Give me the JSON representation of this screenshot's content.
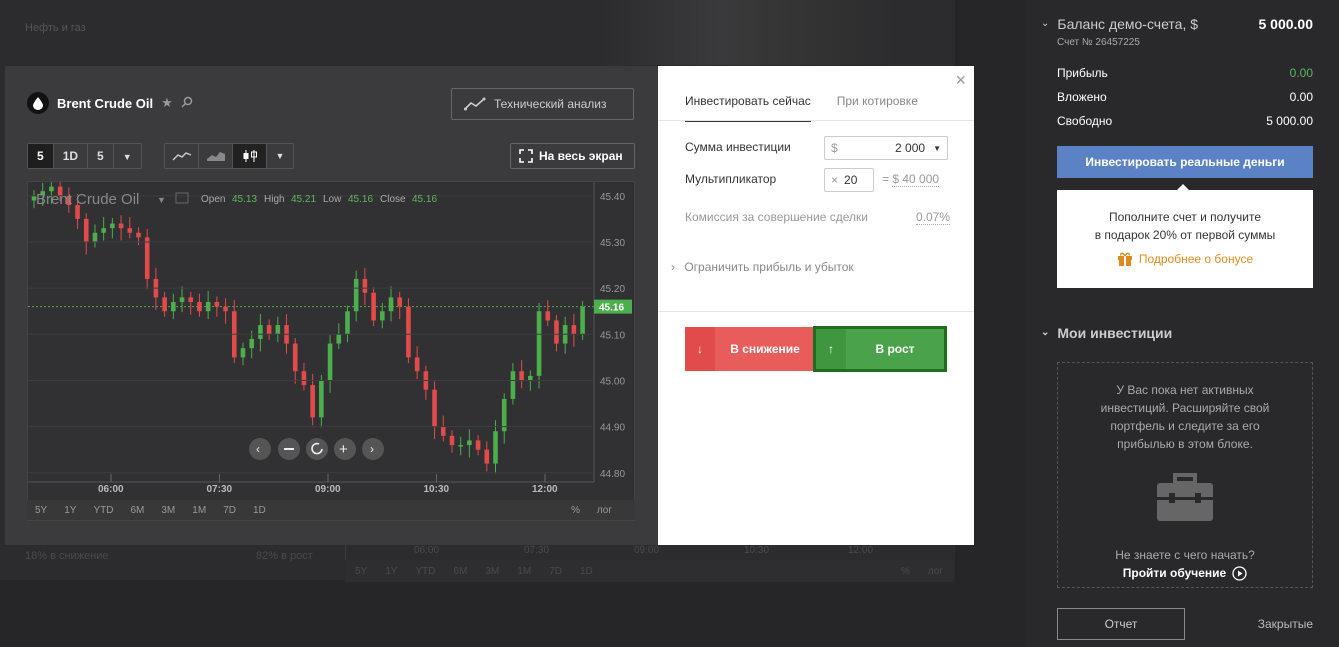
{
  "background": {
    "title": "Нефть и газ",
    "stat_down": "18% в снижение",
    "stat_up": "82% в рост",
    "axis_times": [
      "06:00",
      "07:30",
      "09:00",
      "10:30",
      "12:00"
    ],
    "ranges": [
      "5Y",
      "1Y",
      "YTD",
      "6M",
      "3M",
      "1M",
      "7D",
      "1D"
    ],
    "pct": "%",
    "log": "лог"
  },
  "chart_panel": {
    "asset_name": "Brent Crude Oil",
    "tech_button": "Технический анализ",
    "timeframes": [
      "5",
      "1D",
      "5"
    ],
    "fullscreen": "На весь экран"
  },
  "chart_data": {
    "type": "candlestick",
    "title": "Brent Crude Oil",
    "ohlc_labels": {
      "open_label": "Open",
      "open": "45.13",
      "high_label": "High",
      "high": "45.21",
      "low_label": "Low",
      "low": "45.16",
      "close_label": "Close",
      "close": "45.16"
    },
    "y_ticks": [
      "45.40",
      "45.30",
      "45.20",
      "45.10",
      "45.00",
      "44.90",
      "44.80"
    ],
    "ylim": [
      44.78,
      45.43
    ],
    "x_ticks": [
      "06:00",
      "07:30",
      "09:00",
      "10:30",
      "12:00"
    ],
    "current_price": 45.16,
    "current_price_label": "45.16",
    "closes": [
      45.4,
      45.41,
      45.42,
      45.4,
      45.38,
      45.35,
      45.3,
      45.32,
      45.33,
      45.34,
      45.33,
      45.32,
      45.31,
      45.22,
      45.18,
      45.15,
      45.17,
      45.18,
      45.17,
      45.15,
      45.17,
      45.16,
      45.15,
      45.05,
      45.07,
      45.09,
      45.12,
      45.1,
      45.12,
      45.08,
      45.02,
      44.99,
      44.92,
      45.0,
      45.08,
      45.1,
      45.15,
      45.22,
      45.19,
      45.13,
      45.15,
      45.18,
      45.16,
      45.05,
      45.02,
      44.98,
      44.9,
      44.88,
      44.86,
      44.86,
      44.87,
      44.85,
      44.82,
      44.89,
      44.96,
      45.02,
      45.0,
      45.01,
      45.15,
      45.13,
      45.08,
      45.12,
      45.1,
      45.16
    ],
    "ranges": [
      "5Y",
      "1Y",
      "YTD",
      "6M",
      "3M",
      "1M",
      "7D",
      "1D"
    ],
    "pct": "%",
    "log": "лог"
  },
  "modal": {
    "tab_now": "Инвестировать сейчас",
    "tab_quote": "При котировке",
    "amount_label": "Сумма инвестиции",
    "amount_currency": "$",
    "amount_value": "2 000",
    "mult_label": "Мультипликатор",
    "mult_x": "×",
    "mult_value": "20",
    "mult_eq": "=",
    "mult_result": "$ 40 000",
    "fee_label": "Комиссия за совершение сделки",
    "fee_value": "0.07%",
    "limit_label": "Ограничить прибыль и убыток",
    "down_label": "В снижение",
    "up_label": "В рост"
  },
  "sidebar": {
    "balance_title": "Баланс демо-счета, $",
    "balance_amount": "5 000.00",
    "account": "Счет № 26457225",
    "profit_label": "Прибыль",
    "profit_value": "0.00",
    "invested_label": "Вложено",
    "invested_value": "0.00",
    "free_label": "Свободно",
    "free_value": "5 000.00",
    "real_button": "Инвестировать реальные деньги",
    "promo_line1": "Пополните счет и получите",
    "promo_line2": "в подарок 20% от первой суммы",
    "promo_link": "Подробнее о бонусе",
    "my_investments": "Мои инвестиции",
    "empty_line1": "У Вас пока нет активных",
    "empty_line2": "инвестиций. Расширяйте свой",
    "empty_line3": "портфель и следите за его",
    "empty_line4": "прибылью в этом блоке.",
    "question": "Не знаете с чего начать?",
    "learn": "Пройти обучение",
    "report_button": "Отчет",
    "closed_tab": "Закрытые"
  },
  "colors": {
    "up": "#4cae4c",
    "down": "#e24b4b",
    "accent": "#5b82c4"
  }
}
